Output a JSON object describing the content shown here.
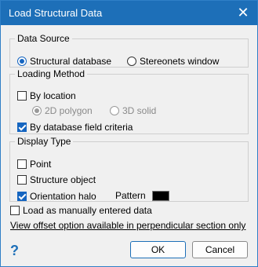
{
  "window": {
    "title": "Load Structural Data",
    "close_symbol": "✕"
  },
  "data_source": {
    "legend": "Data Source",
    "options": [
      {
        "label": "Structural database",
        "selected": true
      },
      {
        "label": "Stereonets window",
        "selected": false
      }
    ]
  },
  "loading_method": {
    "legend": "Loading Method",
    "by_location": {
      "label": "By location",
      "checked": false
    },
    "polygon_2d": {
      "label": "2D polygon",
      "selected": true,
      "disabled": true
    },
    "solid_3d": {
      "label": "3D solid",
      "selected": false,
      "disabled": true
    },
    "by_database_field": {
      "label": "By database field criteria",
      "checked": true
    }
  },
  "display_type": {
    "legend": "Display Type",
    "point": {
      "label": "Point",
      "checked": false
    },
    "structure_object": {
      "label": "Structure object",
      "checked": false
    },
    "orientation_halo": {
      "label": "Orientation halo",
      "checked": true
    },
    "pattern_label": "Pattern",
    "pattern_color": "#000000"
  },
  "load_manual": {
    "label": "Load as manually entered data",
    "checked": false
  },
  "offset_link": "View offset option available in perpendicular section only",
  "help_symbol": "?",
  "buttons": {
    "ok": "OK",
    "cancel": "Cancel"
  }
}
